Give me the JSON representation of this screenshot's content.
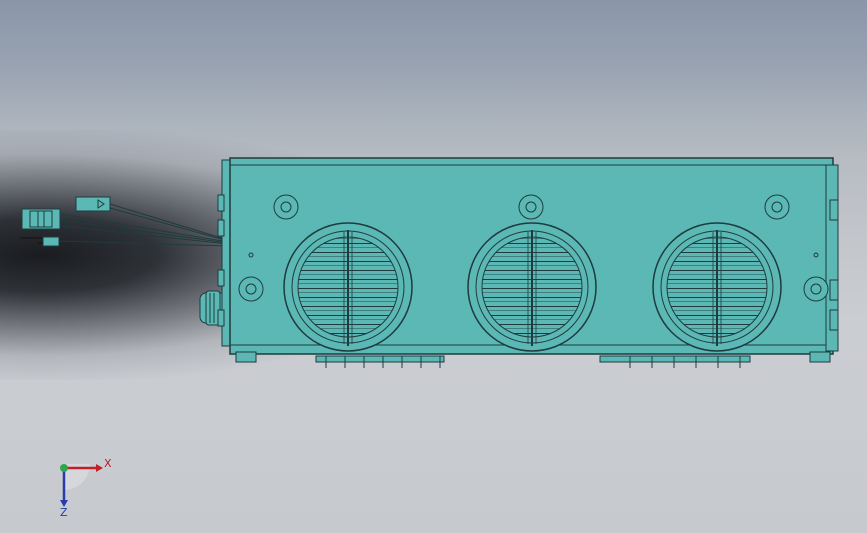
{
  "viewport": {
    "background_colors": [
      "#8a96a8",
      "#c9ccd1"
    ],
    "model_color": "#5bb8b5",
    "edge_color": "#1e3c3e"
  },
  "model": {
    "fan_count": 3,
    "icons": [
      "heater-unit-body",
      "fan-grille-icon",
      "wire-harness",
      "cable-gland"
    ]
  },
  "triad": {
    "x_label": "X",
    "z_label": "Z",
    "x_color": "#c0202a",
    "z_color": "#2a3aa8",
    "y_color": "#2aa84a"
  }
}
